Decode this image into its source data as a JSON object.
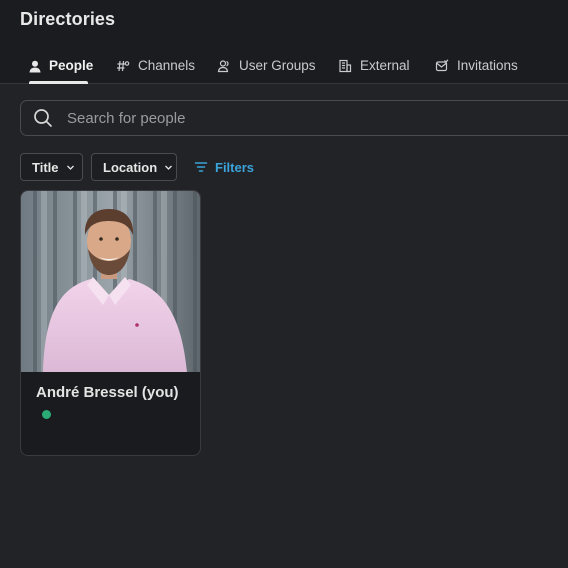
{
  "header": {
    "title": "Directories"
  },
  "tabs": [
    {
      "label": "People",
      "icon": "person-icon",
      "active": true
    },
    {
      "label": "Channels",
      "icon": "channel-hash-icon",
      "active": false
    },
    {
      "label": "User Groups",
      "icon": "user-group-icon",
      "active": false
    },
    {
      "label": "External",
      "icon": "building-icon",
      "active": false
    },
    {
      "label": "Invitations",
      "icon": "invitation-icon",
      "active": false
    }
  ],
  "search": {
    "placeholder": "Search for people",
    "value": ""
  },
  "filters": {
    "title_label": "Title",
    "location_label": "Location",
    "filters_label": "Filters"
  },
  "people": [
    {
      "name": "André Bressel (you)",
      "status": "active",
      "status_color": "#2bac76"
    }
  ],
  "colors": {
    "accent": "#3aa3d9",
    "background": "#222327",
    "header_background": "#1b1c20",
    "online": "#2bac76"
  }
}
